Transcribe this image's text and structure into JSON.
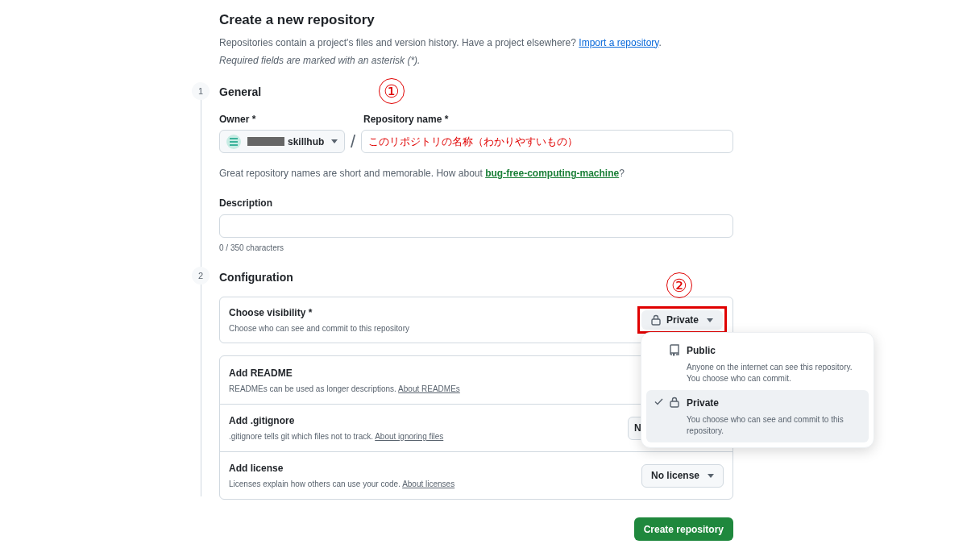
{
  "header": {
    "title": "Create a new repository",
    "intro": "Repositories contain a project's files and version history. Have a project elsewhere?",
    "import_link": "Import a repository",
    "intro_end": ".",
    "required_note": "Required fields are marked with an asterisk (*)."
  },
  "general": {
    "step": "1",
    "heading": "General",
    "owner_label": "Owner *",
    "owner_value": "skillhub",
    "owner_redacted": true,
    "separator": "/",
    "name_label": "Repository name *",
    "name_value": "このリポジトリの名称（わかりやすいもの）",
    "hint": "Great repository names are short and memorable. How about",
    "suggestion": "bug-free-computing-machine",
    "hint_end": "?",
    "description_label": "Description",
    "char_count": "0 / 350 characters",
    "annotation": "①"
  },
  "configuration": {
    "step": "2",
    "heading": "Configuration",
    "annotation": "②",
    "visibility": {
      "title": "Choose visibility *",
      "subtitle": "Choose who can see and commit to this repository",
      "button": "Private",
      "highlighted": true
    },
    "rows": [
      {
        "title": "Add README",
        "subtitle": "READMEs can be used as longer descriptions.",
        "link": "About READMEs",
        "button": null
      },
      {
        "title": "Add .gitignore",
        "subtitle": ".gitignore tells git which files not to track.",
        "link": "About ignoring files",
        "button": "N"
      },
      {
        "title": "Add license",
        "subtitle": "Licenses explain how others can use your code.",
        "link": "About licenses",
        "button": "No license"
      }
    ]
  },
  "visibility_menu": [
    {
      "label": "Public",
      "description": "Anyone on the internet can see this repository. You choose who can commit.",
      "kind": "public",
      "selected": false
    },
    {
      "label": "Private",
      "description": "You choose who can see and commit to this repository.",
      "kind": "private",
      "selected": true
    }
  ],
  "create_button": "Create repository"
}
